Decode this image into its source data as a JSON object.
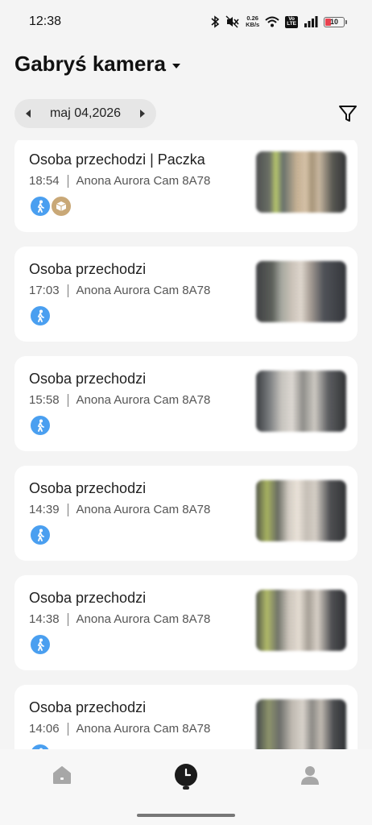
{
  "status_bar": {
    "time": "12:38",
    "net_speed_value": "0.26",
    "net_speed_unit": "KB/s",
    "volte_line1": "Vo",
    "volte_line2": "LTE",
    "battery": "10",
    "icons": [
      "bluetooth-icon",
      "mute-icon",
      "wifi-icon",
      "signal-icon",
      "battery-icon"
    ],
    "battery_color": "#e9414f"
  },
  "header": {
    "title": "Gabryś kamera"
  },
  "date_picker": {
    "date": "maj 04,2026"
  },
  "events": [
    {
      "title": "Osoba przechodzi | Paczka",
      "time": "18:54",
      "camera": "Anona Aurora Cam 8A78",
      "badges": [
        "person",
        "package"
      ]
    },
    {
      "title": "Osoba przechodzi",
      "time": "17:03",
      "camera": "Anona Aurora Cam 8A78",
      "badges": [
        "person"
      ]
    },
    {
      "title": "Osoba przechodzi",
      "time": "15:58",
      "camera": "Anona Aurora Cam 8A78",
      "badges": [
        "person"
      ]
    },
    {
      "title": "Osoba przechodzi",
      "time": "14:39",
      "camera": "Anona Aurora Cam 8A78",
      "badges": [
        "person"
      ]
    },
    {
      "title": "Osoba przechodzi",
      "time": "14:38",
      "camera": "Anona Aurora Cam 8A78",
      "badges": [
        "person"
      ]
    },
    {
      "title": "Osoba przechodzi",
      "time": "14:06",
      "camera": "Anona Aurora Cam 8A78",
      "badges": [
        "person"
      ]
    }
  ],
  "bottom_nav": {
    "items": [
      "home-icon",
      "history-icon",
      "profile-icon"
    ],
    "active": "history-icon"
  },
  "colors": {
    "person_badge": "#4a9ff0",
    "package_badge": "#c9a877",
    "background": "#f4f4f4"
  }
}
